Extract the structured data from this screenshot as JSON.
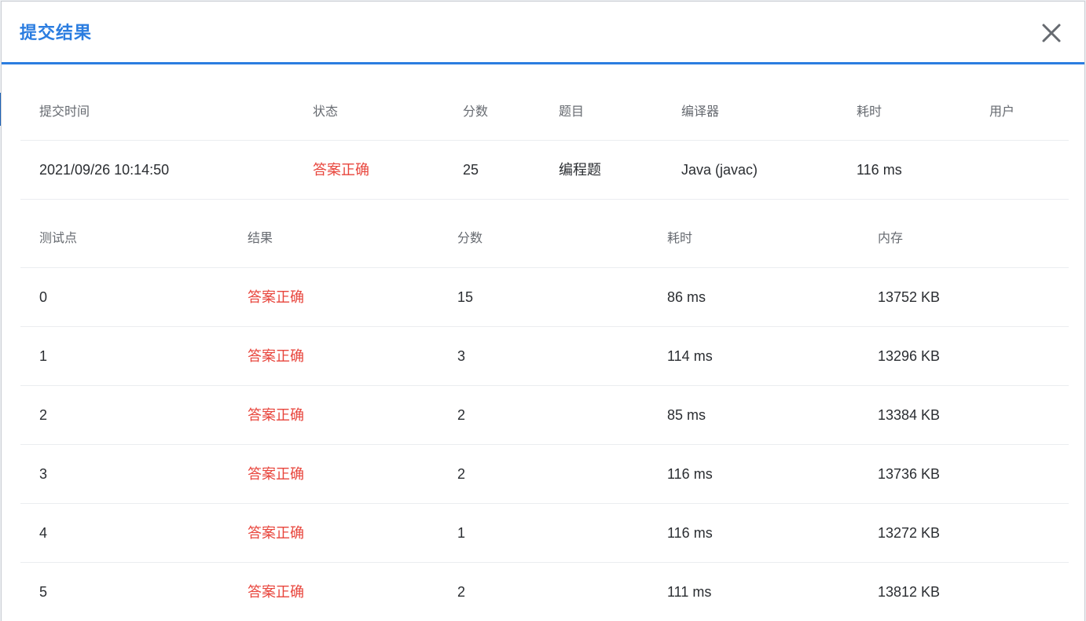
{
  "dialog": {
    "title": "提交结果"
  },
  "summary": {
    "headers": {
      "time": "提交时间",
      "status": "状态",
      "score": "分数",
      "problem": "题目",
      "compiler": "编译器",
      "elapsed": "耗时",
      "user": "用户"
    },
    "row": {
      "time": "2021/09/26 10:14:50",
      "status": "答案正确",
      "score": "25",
      "problem": "编程题",
      "compiler": "Java (javac)",
      "elapsed": "116 ms",
      "user": ""
    }
  },
  "testcases": {
    "headers": {
      "case": "测试点",
      "result": "结果",
      "score": "分数",
      "elapsed": "耗时",
      "memory": "内存"
    },
    "rows": [
      {
        "case": "0",
        "result": "答案正确",
        "score": "15",
        "elapsed": "86 ms",
        "memory": "13752 KB"
      },
      {
        "case": "1",
        "result": "答案正确",
        "score": "3",
        "elapsed": "114 ms",
        "memory": "13296 KB"
      },
      {
        "case": "2",
        "result": "答案正确",
        "score": "2",
        "elapsed": "85 ms",
        "memory": "13384 KB"
      },
      {
        "case": "3",
        "result": "答案正确",
        "score": "2",
        "elapsed": "116 ms",
        "memory": "13736 KB"
      },
      {
        "case": "4",
        "result": "答案正确",
        "score": "1",
        "elapsed": "116 ms",
        "memory": "13272 KB"
      },
      {
        "case": "5",
        "result": "答案正确",
        "score": "2",
        "elapsed": "111 ms",
        "memory": "13812 KB"
      }
    ]
  },
  "colors": {
    "accent": "#2b7de0",
    "success_text": "#e8453c"
  },
  "icons": {
    "close": "close-icon"
  }
}
